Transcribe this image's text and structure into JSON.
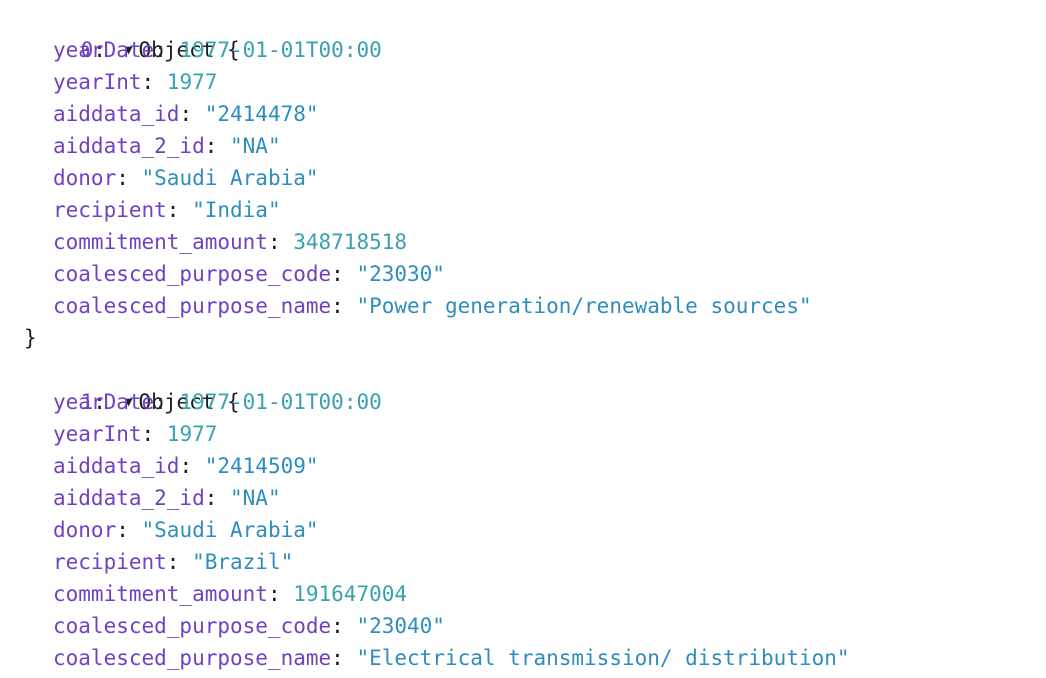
{
  "objects": [
    {
      "index": "0",
      "arrow_icon": "triangle-down",
      "type_label": "Object",
      "fields": [
        {
          "key": "yearDate",
          "value": "1977-01-01T00:00",
          "kind": "date"
        },
        {
          "key": "yearInt",
          "value": "1977",
          "kind": "num"
        },
        {
          "key": "aiddata_id",
          "value": "\"2414478\"",
          "kind": "str"
        },
        {
          "key": "aiddata_2_id",
          "value": "\"NA\"",
          "kind": "str"
        },
        {
          "key": "donor",
          "value": "\"Saudi Arabia\"",
          "kind": "str"
        },
        {
          "key": "recipient",
          "value": "\"India\"",
          "kind": "str"
        },
        {
          "key": "commitment_amount",
          "value": "348718518",
          "kind": "num"
        },
        {
          "key": "coalesced_purpose_code",
          "value": "\"23030\"",
          "kind": "str"
        },
        {
          "key": "coalesced_purpose_name",
          "value": "\"Power generation/renewable sources\"",
          "kind": "str"
        }
      ]
    },
    {
      "index": "1",
      "arrow_icon": "triangle-down",
      "type_label": "Object",
      "fields": [
        {
          "key": "yearDate",
          "value": "1977-01-01T00:00",
          "kind": "date"
        },
        {
          "key": "yearInt",
          "value": "1977",
          "kind": "num"
        },
        {
          "key": "aiddata_id",
          "value": "\"2414509\"",
          "kind": "str"
        },
        {
          "key": "aiddata_2_id",
          "value": "\"NA\"",
          "kind": "str"
        },
        {
          "key": "donor",
          "value": "\"Saudi Arabia\"",
          "kind": "str"
        },
        {
          "key": "recipient",
          "value": "\"Brazil\"",
          "kind": "str"
        },
        {
          "key": "commitment_amount",
          "value": "191647004",
          "kind": "num"
        },
        {
          "key": "coalesced_purpose_code",
          "value": "\"23040\"",
          "kind": "str"
        },
        {
          "key": "coalesced_purpose_name",
          "value": "\"Electrical transmission/ distribution\"",
          "kind": "str"
        }
      ]
    }
  ]
}
